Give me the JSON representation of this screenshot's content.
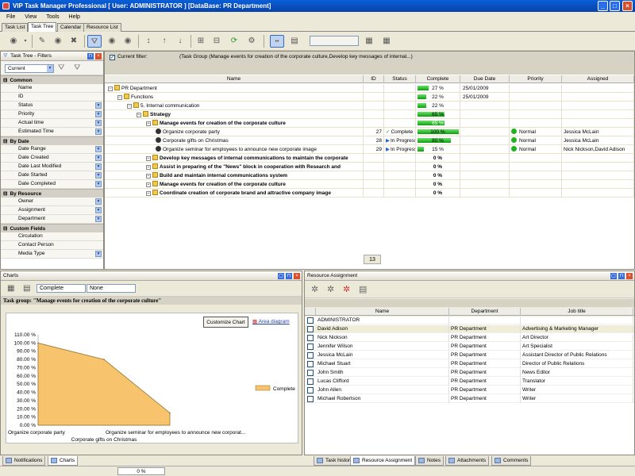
{
  "window": {
    "title": "VIP Task Manager Professional [ User: ADMINISTRATOR ] [DataBase: PR Department]"
  },
  "menu": [
    "File",
    "View",
    "Tools",
    "Help"
  ],
  "tabs": [
    {
      "label": "Task List",
      "active": false
    },
    {
      "label": "Task Tree",
      "active": true
    },
    {
      "label": "Calendar",
      "active": false
    },
    {
      "label": "Resource List",
      "active": false
    }
  ],
  "filters": {
    "title": "Task Tree - Filters",
    "preset": "Current",
    "sections": [
      {
        "name": "Common",
        "items": [
          {
            "label": "Name",
            "dropdown": false
          },
          {
            "label": "ID",
            "dropdown": false
          },
          {
            "label": "Status",
            "dropdown": true
          },
          {
            "label": "Priority",
            "dropdown": true
          },
          {
            "label": "Actual time",
            "dropdown": true
          },
          {
            "label": "Estimated Time",
            "dropdown": true
          }
        ]
      },
      {
        "name": "By Date",
        "items": [
          {
            "label": "Date Range",
            "dropdown": true
          },
          {
            "label": "Date Created",
            "dropdown": true
          },
          {
            "label": "Date Last Modified",
            "dropdown": true
          },
          {
            "label": "Date Started",
            "dropdown": true
          },
          {
            "label": "Date Completed",
            "dropdown": true
          }
        ]
      },
      {
        "name": "By Resource",
        "items": [
          {
            "label": "Owner",
            "dropdown": true
          },
          {
            "label": "Assignment",
            "dropdown": true
          },
          {
            "label": "Department",
            "dropdown": true
          }
        ]
      },
      {
        "name": "Custom Fields",
        "items": [
          {
            "label": "Circulation",
            "dropdown": false
          },
          {
            "label": "Contact Person",
            "dropdown": false
          },
          {
            "label": "Media Type",
            "dropdown": true
          }
        ]
      }
    ]
  },
  "current_filter": {
    "label": "Current filter:",
    "text": "(Task Group  (Manage events for creation of the corporate culture,Develop key messages of internal...)"
  },
  "tree": {
    "columns": [
      "Name",
      "ID",
      "Status",
      "Complete",
      "Due Date",
      "Priority",
      "Assigned"
    ],
    "rows": [
      {
        "name": "PR Department",
        "level": 0,
        "kind": "group",
        "id": "",
        "status": "",
        "complete": 27,
        "complete_label": "27 %",
        "due": "25/01/2009",
        "priority": "",
        "assigned": "",
        "bold": false
      },
      {
        "name": "Functions",
        "level": 1,
        "kind": "group",
        "id": "",
        "status": "",
        "complete": 22,
        "complete_label": "22 %",
        "due": "25/01/2009",
        "priority": "",
        "assigned": "",
        "bold": false
      },
      {
        "name": "5. Internal communication",
        "level": 2,
        "kind": "group",
        "id": "",
        "status": "",
        "complete": 22,
        "complete_label": "22 %",
        "due": "",
        "priority": "",
        "assigned": "",
        "bold": false
      },
      {
        "name": "Strategy",
        "level": 3,
        "kind": "group",
        "id": "",
        "status": "",
        "complete": 65,
        "complete_label": "65 %",
        "due": "",
        "priority": "",
        "assigned": "",
        "bold": true
      },
      {
        "name": "Manage events for creation of the corporate culture",
        "level": 4,
        "kind": "selected",
        "id": "",
        "status": "",
        "complete": 65,
        "complete_label": "65 %",
        "due": "",
        "priority": "",
        "assigned": "",
        "bold": true
      },
      {
        "name": "Organize corporate party",
        "level": 5,
        "kind": "task",
        "id": "27",
        "status": "Complete",
        "complete": 100,
        "complete_label": "100 %",
        "due": "",
        "priority": "Normal",
        "assigned": "Jessica McLain",
        "bold": false
      },
      {
        "name": "Corporate gifts on Christmas",
        "level": 5,
        "kind": "task",
        "id": "28",
        "status": "In Progress",
        "complete": 80,
        "complete_label": "80 %",
        "due": "",
        "priority": "Normal",
        "assigned": "Jessica McLain",
        "bold": false
      },
      {
        "name": "Organize seminar for employees to announce new corporate image",
        "level": 5,
        "kind": "task",
        "id": "29",
        "status": "In Progress",
        "complete": 15,
        "complete_label": "15 %",
        "due": "",
        "priority": "Normal",
        "assigned": "Nick Nickson,David Adison",
        "bold": false
      },
      {
        "name": "Develop key messages of internal communications to maintain the corporate",
        "level": 4,
        "kind": "group",
        "id": "",
        "status": "",
        "complete": 0,
        "complete_label": "0 %",
        "due": "",
        "priority": "",
        "assigned": "",
        "bold": true
      },
      {
        "name": "Assist in preparing of the \"News\" block in cooperation with Research and",
        "level": 4,
        "kind": "group",
        "id": "",
        "status": "",
        "complete": 0,
        "complete_label": "0 %",
        "due": "",
        "priority": "",
        "assigned": "",
        "bold": true
      },
      {
        "name": "Build and maintain internal communications system",
        "level": 4,
        "kind": "group",
        "id": "",
        "status": "",
        "complete": 0,
        "complete_label": "0 %",
        "due": "",
        "priority": "",
        "assigned": "",
        "bold": true
      },
      {
        "name": "Manage events for creation of the corporate culture",
        "level": 4,
        "kind": "group",
        "id": "",
        "status": "",
        "complete": 0,
        "complete_label": "0 %",
        "due": "",
        "priority": "",
        "assigned": "",
        "bold": true
      },
      {
        "name": "Coordinate creation of corporate brand and attractive company image",
        "level": 4,
        "kind": "group",
        "id": "",
        "status": "",
        "complete": 0,
        "complete_label": "0 %",
        "due": "",
        "priority": "",
        "assigned": "",
        "bold": true
      }
    ],
    "count": "13"
  },
  "charts": {
    "title": "Charts",
    "field": "Complete",
    "group_by": "None",
    "group_title": "Task group: \"Manage events for creation of the corporate culture\"",
    "customize_label": "Customize Chart",
    "area_link": "Area diagram",
    "tabs": [
      "Notifications",
      "Charts"
    ]
  },
  "chart_data": {
    "type": "area",
    "categories": [
      "Organize corporate party",
      "Corporate gifts on Christmas",
      "Organize seminar for employees to announce new corporat..."
    ],
    "series": [
      {
        "name": "Complete",
        "values": [
          100,
          80,
          15
        ]
      }
    ],
    "ylim": [
      0,
      110
    ],
    "yticks": [
      "0.00 %",
      "10.00 %",
      "20.00 %",
      "30.00 %",
      "40.00 %",
      "50.00 %",
      "60.00 %",
      "70.00 %",
      "80.00 %",
      "90.00 %",
      "100.00 %",
      "110.00 %"
    ],
    "legend": "right",
    "color": "#f7c36c"
  },
  "resources": {
    "title": "Resource Assignment",
    "columns": [
      "Name",
      "Department",
      "Job title"
    ],
    "rows": [
      {
        "name": "ADMINISTRATOR",
        "department": "",
        "job": "",
        "highlight": false
      },
      {
        "name": "David Adison",
        "department": "PR Department",
        "job": "Advertising & Marketing Manager",
        "highlight": true
      },
      {
        "name": "Nick Nickson",
        "department": "PR Department",
        "job": "Art Director",
        "highlight": false
      },
      {
        "name": "Jennifer Wilson",
        "department": "PR Department",
        "job": "Art Specialist",
        "highlight": false
      },
      {
        "name": "Jessica McLain",
        "department": "PR Department",
        "job": "Assistant Director of Public Relations",
        "highlight": false
      },
      {
        "name": "Michael Stuart",
        "department": "PR Department",
        "job": "Director of Public Relations",
        "highlight": false
      },
      {
        "name": "John Smith",
        "department": "PR Department",
        "job": "News Editor",
        "highlight": false
      },
      {
        "name": "Lucas Clifford",
        "department": "PR Department",
        "job": "Translator",
        "highlight": false
      },
      {
        "name": "John Allen",
        "department": "PR Department",
        "job": "Writer",
        "highlight": false
      },
      {
        "name": "Michael Robertson",
        "department": "PR Department",
        "job": "Writer",
        "highlight": false
      }
    ],
    "tabs": [
      "Task history",
      "Resource Assignment",
      "Notes",
      "Attachments",
      "Comments"
    ]
  },
  "status": {
    "progress": "0 %"
  }
}
